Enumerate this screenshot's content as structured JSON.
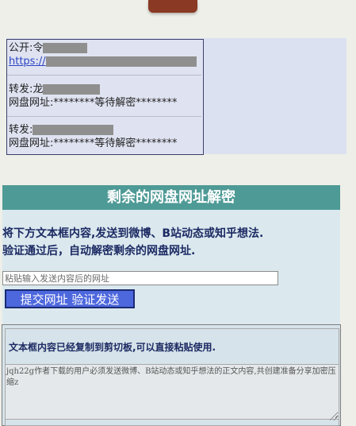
{
  "links": {
    "public_label": "公开:",
    "public_prefix": "令",
    "public_url_prefix": "https://",
    "forward1_label": "转发:",
    "forward1_prefix": "龙",
    "forward1_pan": "网盘网址:********等待解密********",
    "forward2_label": "转发:",
    "forward2_pan": "网盘网址:********等待解密********"
  },
  "section": {
    "title": "剩余的网盘网址解密",
    "instruction_1": "将下方文本框内容,发送到微博、B站动态或知乎想法.",
    "instruction_2": "验证通过后，自动解密剩余的网盘网址."
  },
  "form": {
    "url_placeholder": "粘贴输入发送内容后的网址",
    "submit_label": "提交网址 验证发送"
  },
  "clipboard": {
    "title": "文本框内容已经复制到剪切板,可以直接粘贴使用.",
    "text": "jqh22g作者下载的用户必须发送微博、B站动态或知乎想法的正文内容,共创建准备分享加密压缩z"
  },
  "colors": {
    "header_teal": "#4e9a96",
    "button_blue": "#4d67dd",
    "instruction_navy": "#1c2a63",
    "link_blue": "#2c44c4"
  }
}
